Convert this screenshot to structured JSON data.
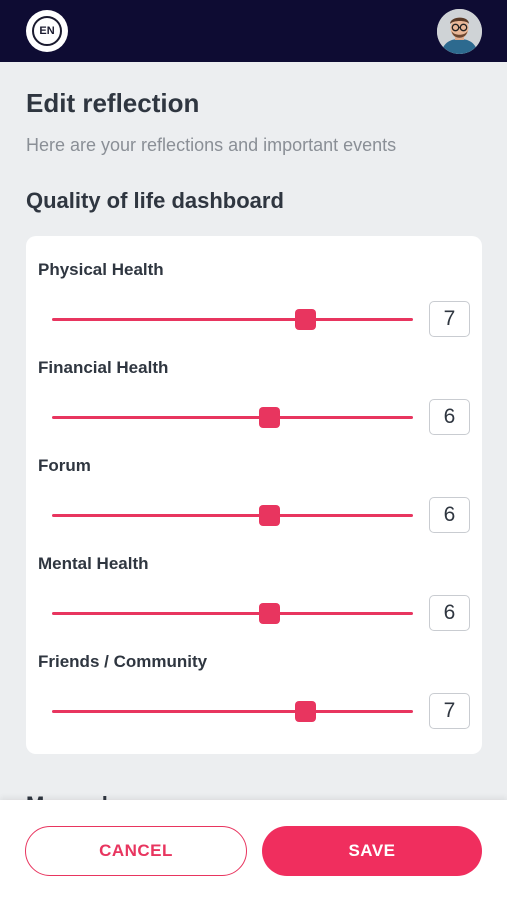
{
  "header": {
    "language_code": "EN",
    "avatar_icon": "user-avatar-icon",
    "colors": {
      "background": "#0e0c33"
    }
  },
  "main": {
    "title": "Edit reflection",
    "subtitle": "Here are your reflections and important events",
    "section_title": "Quality of life dashboard",
    "next_section_title": "My goals"
  },
  "dashboard": {
    "slider_min": 0,
    "slider_max": 10,
    "metrics": [
      {
        "label": "Physical Health",
        "value": "7"
      },
      {
        "label": "Financial Health",
        "value": "6"
      },
      {
        "label": "Forum",
        "value": "6"
      },
      {
        "label": "Mental Health",
        "value": "6"
      },
      {
        "label": "Friends / Community",
        "value": "7"
      }
    ]
  },
  "footer": {
    "cancel_label": "CANCEL",
    "save_label": "SAVE"
  },
  "colors": {
    "accent": "#e8355f",
    "save_button": "#f02e5e"
  }
}
